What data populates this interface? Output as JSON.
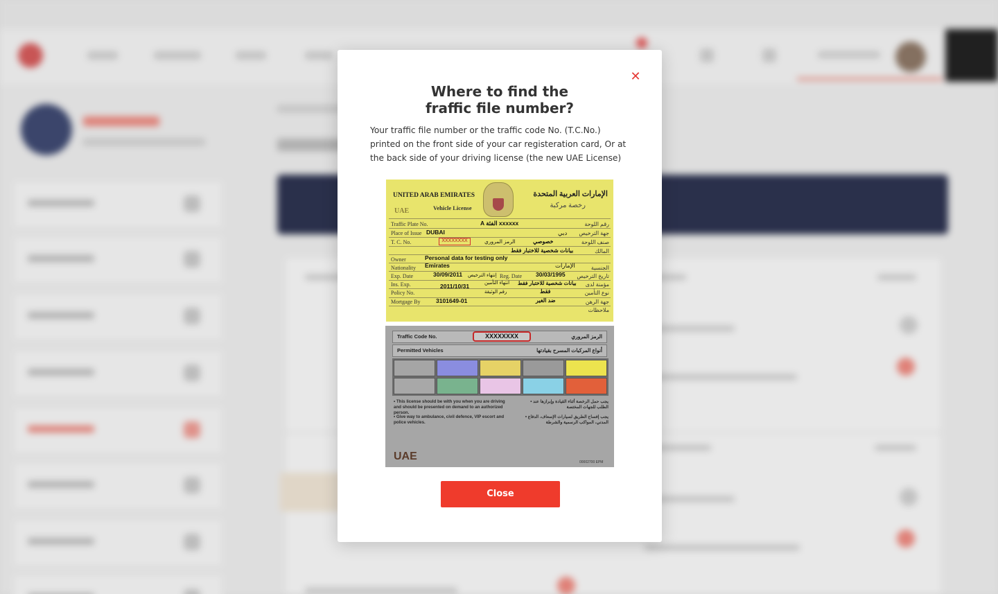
{
  "modal": {
    "title_line1": "Where to find the",
    "title_line2": "fraffic file number?",
    "description": "Your traffic file number or the traffic code No. (T.C.No.) printed on the front side of your car registeration card,  Or at the back side of your driving license (the new UAE License)",
    "close_button_label": "Close",
    "close_icon": "close-icon",
    "accent_color": "#ef3b2c"
  },
  "vehicle_license": {
    "header_en": "UNITED ARAB EMIRATES",
    "subheader_en": "Vehicle License",
    "header_ar": "الإمارات العربية المتحدة",
    "subheader_ar": "رخصة مركبة",
    "logo_text": "UAE",
    "plate_value": "A الفئة xxxxxx",
    "place_value": "DUBAI",
    "place_ar": "دبي",
    "tc_value": "XXXXXXXX",
    "tc_ar": "الرمز المروري",
    "plate_class_ar": "خصوصي",
    "owner_ar_note": "بيانات شخصية للاختبار فقط",
    "owner_value": "Personal data for testing only",
    "nationality_value": "Emirates",
    "nationality_ar": "الإمارات",
    "exp_date": "30/09/2011",
    "exp_ar": "إنتهاء الترخيص",
    "reg_date": "30/03/1995",
    "ins_exp": "2011/10/31",
    "ins_ar": "انتهاء التأمين",
    "policy_ar": "رقم الوثيقة",
    "policy_type_ar": "فقط",
    "mortgage_value": "3101649-01",
    "mortgage_ar": "ضد الغير",
    "labels": {
      "plate": "Traffic Plate No.",
      "place": "Place of Issue",
      "tc": "T. C. No.",
      "owner": "Owner",
      "nationality": "Nationality",
      "exp": "Exp. Date",
      "reg": "Reg. Date",
      "ins": "Ins. Exp.",
      "policy": "Policy No.",
      "mortgage": "Mortgage By"
    },
    "labels_ar": {
      "plate": "رقم اللوحة",
      "place": "جهة الترخيص",
      "tc": "صنف اللوحة",
      "owner": "المالك",
      "nationality": "الجنسية",
      "exp": "تاريخ الترخيص",
      "ins": "مؤمنة لدى",
      "policy": "نوع التأمين",
      "mortgage": "جهة الرهن",
      "notes": "ملاحظات"
    }
  },
  "driving_license": {
    "tc_label": "Traffic Code No.",
    "tc_label_ar": "الرمز المروري",
    "tc_value": "XXXXXXXX",
    "permitted_label": "Permitted Vehicles",
    "permitted_label_ar": "أنواع المركبات المسرح بقيادتها",
    "note1_en": "• This license should be with you when you are driving and should be presented on demand to an authorized person.",
    "note2_en": "• Give way to ambulance, civil defence, VIP escort and police vehicles.",
    "note1_ar": "• يجب حمل الرخصة أثناء القيادة وإبرازها عند الطلب للجهات المختصة",
    "note2_ar": "• يجب إفساح الطريق لسيارات الإسعاف، الدفاع المدني، المواكب الرسمية والشرطة",
    "country": "UAE",
    "footer_code": "00002700 EPM",
    "colors_row1": [
      "#a5a5a5",
      "#8a8de0",
      "#e6d266",
      "#9a9a9a",
      "#ece34e"
    ],
    "colors_row2": [
      "#a8a8a8",
      "#79b38e",
      "#e9c5e6",
      "#8ad1e6",
      "#e2603a"
    ]
  }
}
